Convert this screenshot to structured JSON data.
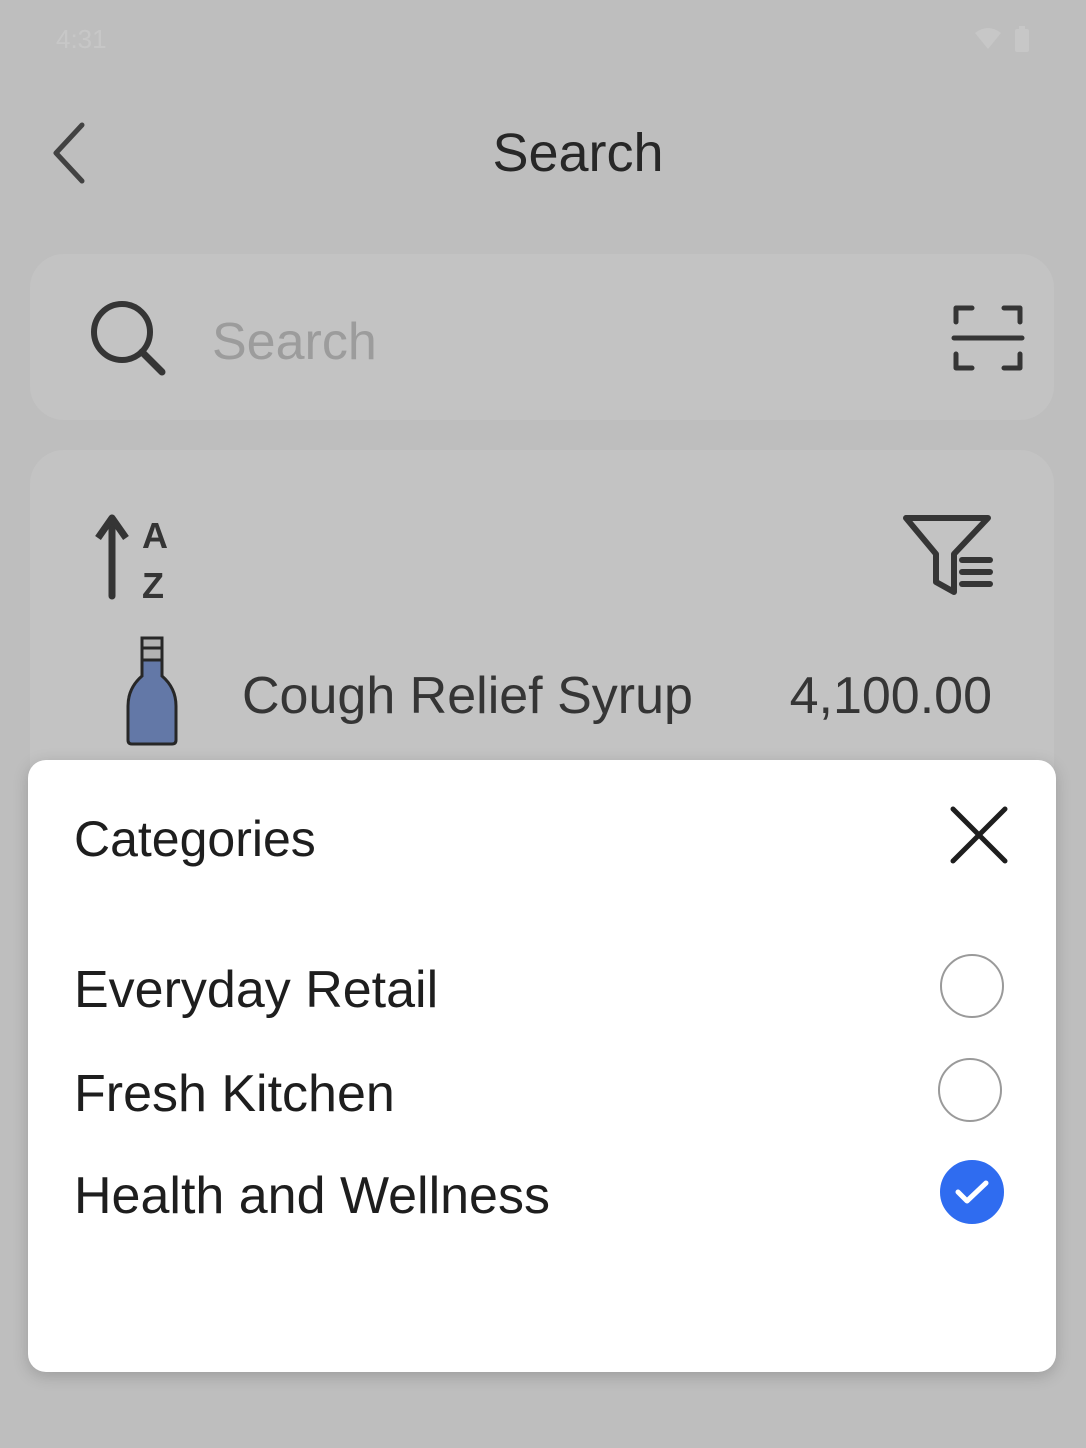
{
  "status_bar": {
    "time": "4:31"
  },
  "header": {
    "title": "Search"
  },
  "search": {
    "placeholder": "Search"
  },
  "product": {
    "name": "Cough Relief Syrup",
    "price": "4,100.00"
  },
  "categories_sheet": {
    "title": "Categories",
    "options": [
      {
        "label": "Everyday Retail",
        "selected": false
      },
      {
        "label": "Fresh Kitchen",
        "selected": false
      },
      {
        "label": "Health and Wellness",
        "selected": true
      }
    ]
  },
  "colors": {
    "accent": "#2f6cf0",
    "product_icon": "#7f9ad6"
  },
  "icons": {
    "back": "chevron-left-icon",
    "search": "search-icon",
    "scan": "scan-barcode-icon",
    "sort": "sort-a-z-icon",
    "filter": "filter-icon",
    "product": "bottle-icon",
    "close": "close-icon",
    "check": "check-icon"
  }
}
